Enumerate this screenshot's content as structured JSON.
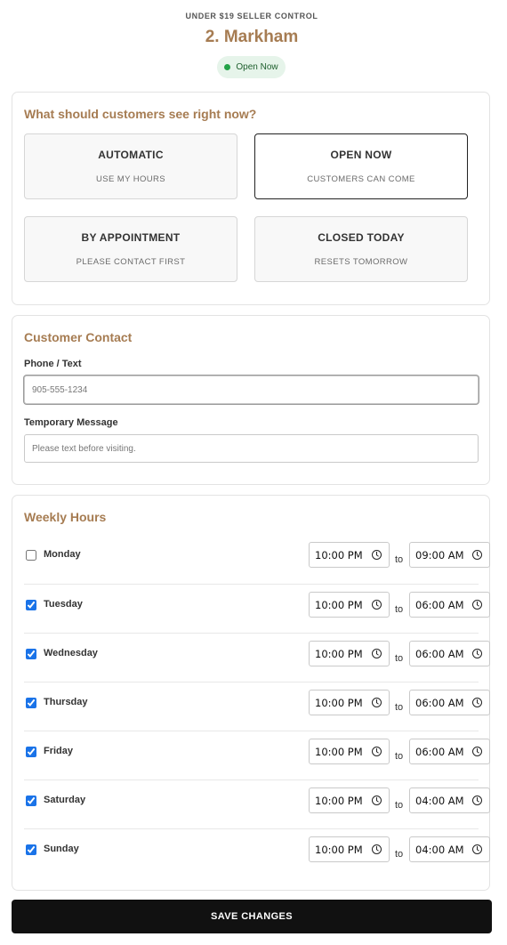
{
  "header": {
    "eyebrow": "UNDER $19 SELLER CONTROL",
    "store_name": "2. Markham",
    "status": "Open Now",
    "status_color": "#22a247"
  },
  "visibility": {
    "title": "What should customers see right now?",
    "options": [
      {
        "title": "AUTOMATIC",
        "subtitle": "USE MY HOURS",
        "selected": false
      },
      {
        "title": "OPEN NOW",
        "subtitle": "CUSTOMERS CAN COME",
        "selected": true
      },
      {
        "title": "BY APPOINTMENT",
        "subtitle": "PLEASE CONTACT FIRST",
        "selected": false
      },
      {
        "title": "CLOSED TODAY",
        "subtitle": "RESETS TOMORROW",
        "selected": false
      }
    ]
  },
  "contact": {
    "title": "Customer Contact",
    "phone_label": "Phone / Text",
    "phone_placeholder": "905-555-1234",
    "message_label": "Temporary Message",
    "message_placeholder": "Please text before visiting."
  },
  "hours": {
    "title": "Weekly Hours",
    "to_label": "to",
    "days": [
      {
        "day": "Monday",
        "enabled": false,
        "open": "10:00 PM",
        "close": "09:00 AM"
      },
      {
        "day": "Tuesday",
        "enabled": true,
        "open": "10:00 PM",
        "close": "06:00 AM"
      },
      {
        "day": "Wednesday",
        "enabled": true,
        "open": "10:00 PM",
        "close": "06:00 AM"
      },
      {
        "day": "Thursday",
        "enabled": true,
        "open": "10:00 PM",
        "close": "06:00 AM"
      },
      {
        "day": "Friday",
        "enabled": true,
        "open": "10:00 PM",
        "close": "06:00 AM"
      },
      {
        "day": "Saturday",
        "enabled": true,
        "open": "10:00 PM",
        "close": "04:00 AM"
      },
      {
        "day": "Sunday",
        "enabled": true,
        "open": "10:00 PM",
        "close": "04:00 AM"
      }
    ]
  },
  "actions": {
    "save_label": "SAVE CHANGES"
  },
  "colors": {
    "accent": "#a67c52",
    "button": "#111111"
  }
}
